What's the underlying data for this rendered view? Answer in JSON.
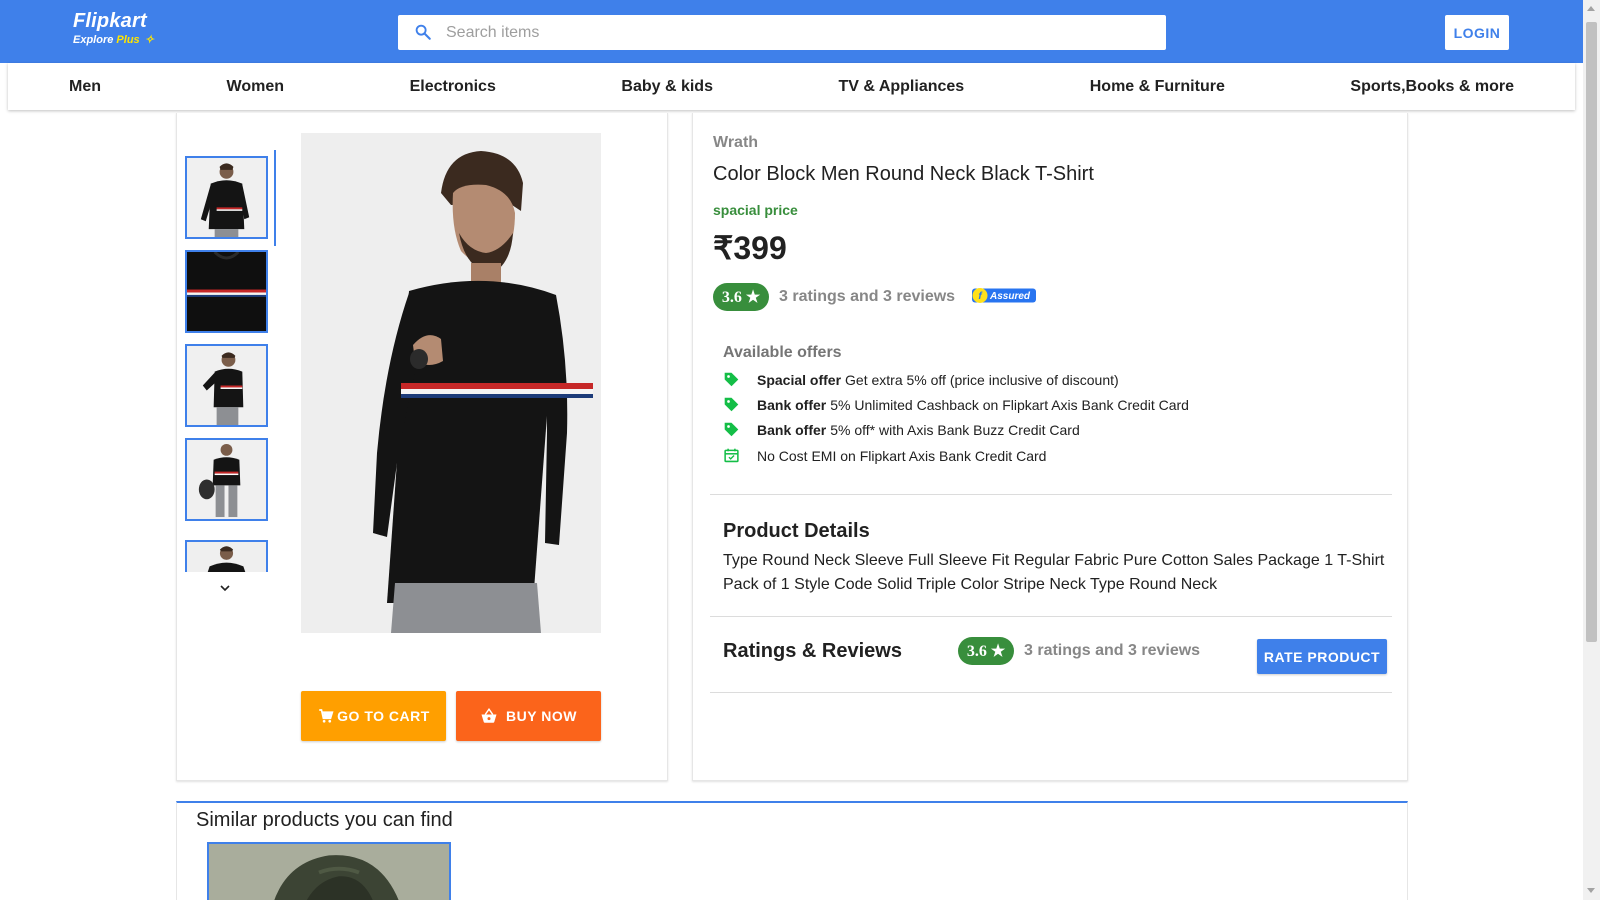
{
  "header": {
    "logo_title": "Flipkart",
    "logo_explore": "Explore",
    "logo_plus": "Plus",
    "search_placeholder": "Search items",
    "login_label": "LOGIN",
    "bg_color": "#3f80ea"
  },
  "categories": [
    "Men",
    "Women",
    "Electronics",
    "Baby & kids",
    "TV & Appliances",
    "Home & Furniture",
    "Sports,Books & more"
  ],
  "gallery": {
    "thumbnails": [
      "front-view",
      "stripe-closeup",
      "side-view",
      "bag-pose",
      "partial"
    ],
    "active_index": 0,
    "go_to_cart_label": "GO TO CART",
    "buy_now_label": "BUY NOW"
  },
  "product": {
    "brand": "Wrath",
    "title": "Color Block Men Round Neck Black T-Shirt",
    "special_label": "spacial price",
    "price": "₹399",
    "rating": "3.6 ★",
    "rating_summary": "3 ratings and 3 reviews",
    "assured_label": "Assured"
  },
  "offers": {
    "title": "Available offers",
    "items": [
      {
        "icon": "tag-icon",
        "bold": "Spacial offer",
        "text": "Get extra 5% off (price inclusive of discount)"
      },
      {
        "icon": "tag-icon",
        "bold": "Bank offer",
        "text": "5% Unlimited Cashback on Flipkart Axis Bank Credit Card"
      },
      {
        "icon": "tag-icon",
        "bold": "Bank offer",
        "text": "5% off* with Axis Bank Buzz Credit Card"
      },
      {
        "icon": "calendar-check-icon",
        "bold": "",
        "text": "No Cost EMI on Flipkart Axis Bank Credit Card"
      }
    ]
  },
  "details": {
    "title": "Product Details",
    "text": "Type Round Neck Sleeve Full Sleeve Fit Regular Fabric Pure Cotton Sales Package 1 T-Shirt Pack of 1 Style Code Solid Triple Color Stripe Neck Type Round Neck"
  },
  "reviews": {
    "title": "Ratings & Reviews",
    "rating": "3.6 ★",
    "summary": "3 ratings and 3 reviews",
    "rate_button": "RATE PRODUCT"
  },
  "similar": {
    "title": "Similar products you can find"
  },
  "colors": {
    "primary": "#3f80ea",
    "green": "#388e3c",
    "cart": "#ff9f00",
    "buy": "#fb641b"
  }
}
